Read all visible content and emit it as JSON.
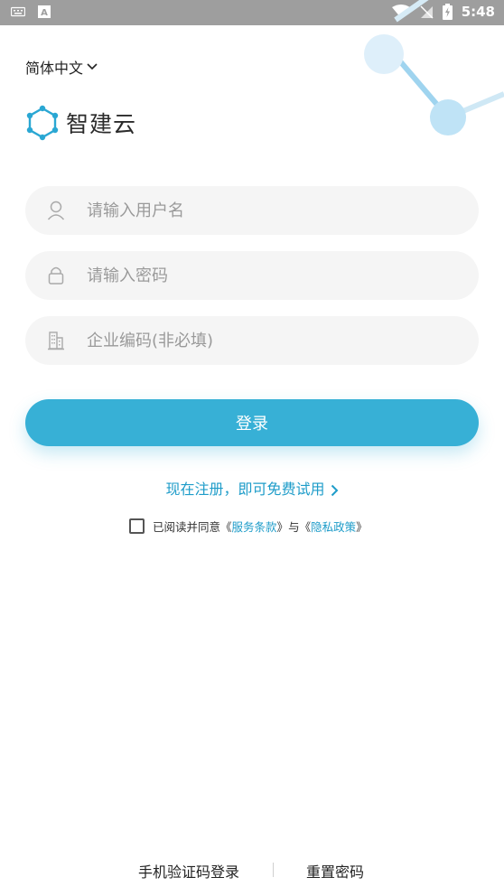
{
  "status_bar": {
    "time": "5:48",
    "icons": [
      "keyboard-icon",
      "a-badge-icon",
      "wifi-icon",
      "no-sim-icon",
      "battery-charging-icon"
    ]
  },
  "language": {
    "label": "简体中文"
  },
  "logo": {
    "text": "智建云"
  },
  "form": {
    "username": {
      "placeholder": "请输入用户名",
      "value": ""
    },
    "password": {
      "placeholder": "请输入密码",
      "value": ""
    },
    "company_code": {
      "placeholder": "企业编码(非必填)",
      "value": ""
    }
  },
  "login_button": {
    "label": "登录"
  },
  "register": {
    "label": "现在注册，即可免费试用"
  },
  "agreement": {
    "prefix": "已阅读并同意",
    "open1": "《",
    "terms": "服务条款",
    "close1": "》",
    "middle": "与",
    "open2": "《",
    "privacy": "隐私政策",
    "close2": "》",
    "checked": false
  },
  "footer": {
    "sms_login": "手机验证码登录",
    "reset_password": "重置密码"
  },
  "colors": {
    "accent": "#37b0d6",
    "link": "#1e9cc9",
    "field_bg": "#f5f5f5",
    "status_bar": "#9e9e9e"
  }
}
